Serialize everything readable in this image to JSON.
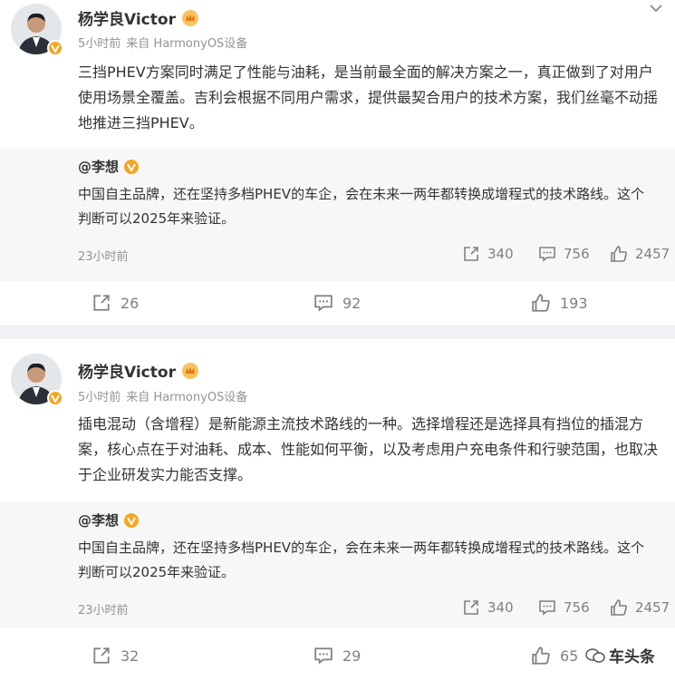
{
  "posts": [
    {
      "author": "杨学良Victor",
      "time": "5小时前",
      "source": "来自 HarmonyOS设备",
      "text": "三挡PHEV方案同时满足了性能与油耗，是当前最全面的解决方案之一，真正做到了对用户使用场景全覆盖。吉利会根据不同用户需求，提供最契合用户的技术方案，我们丝毫不动摇地推进三挡PHEV。",
      "repost": {
        "author": "@李想",
        "text": "中国自主品牌，还在坚持多档PHEV的车企，会在未来一两年都转换成增程式的技术路线。这个判断可以2025年来验证。",
        "time": "23小时前",
        "shares": "340",
        "comments": "756",
        "likes": "2457"
      },
      "shares": "26",
      "comments": "92",
      "likes": "193"
    },
    {
      "author": "杨学良Victor",
      "time": "5小时前",
      "source": "来自 HarmonyOS设备",
      "text": "插电混动（含增程）是新能源主流技术路线的一种。选择增程还是选择具有挡位的插混方案，核心点在于对油耗、成本、性能如何平衡，以及考虑用户充电条件和行驶范围，也取决于企业研发实力能否支撑。",
      "repost": {
        "author": "@李想",
        "text": "中国自主品牌，还在坚持多档PHEV的车企，会在未来一两年都转换成增程式的技术路线。这个判断可以2025年来验证。",
        "time": "23小时前",
        "shares": "340",
        "comments": "756",
        "likes": "2457"
      },
      "shares": "32",
      "comments": "29",
      "likes": "65"
    }
  ],
  "watermark": "车头条",
  "colors": {
    "background": "#f1f2f5",
    "repost_bg": "#f7f7f7",
    "badge": "#f5a623",
    "muted": "#939393"
  }
}
